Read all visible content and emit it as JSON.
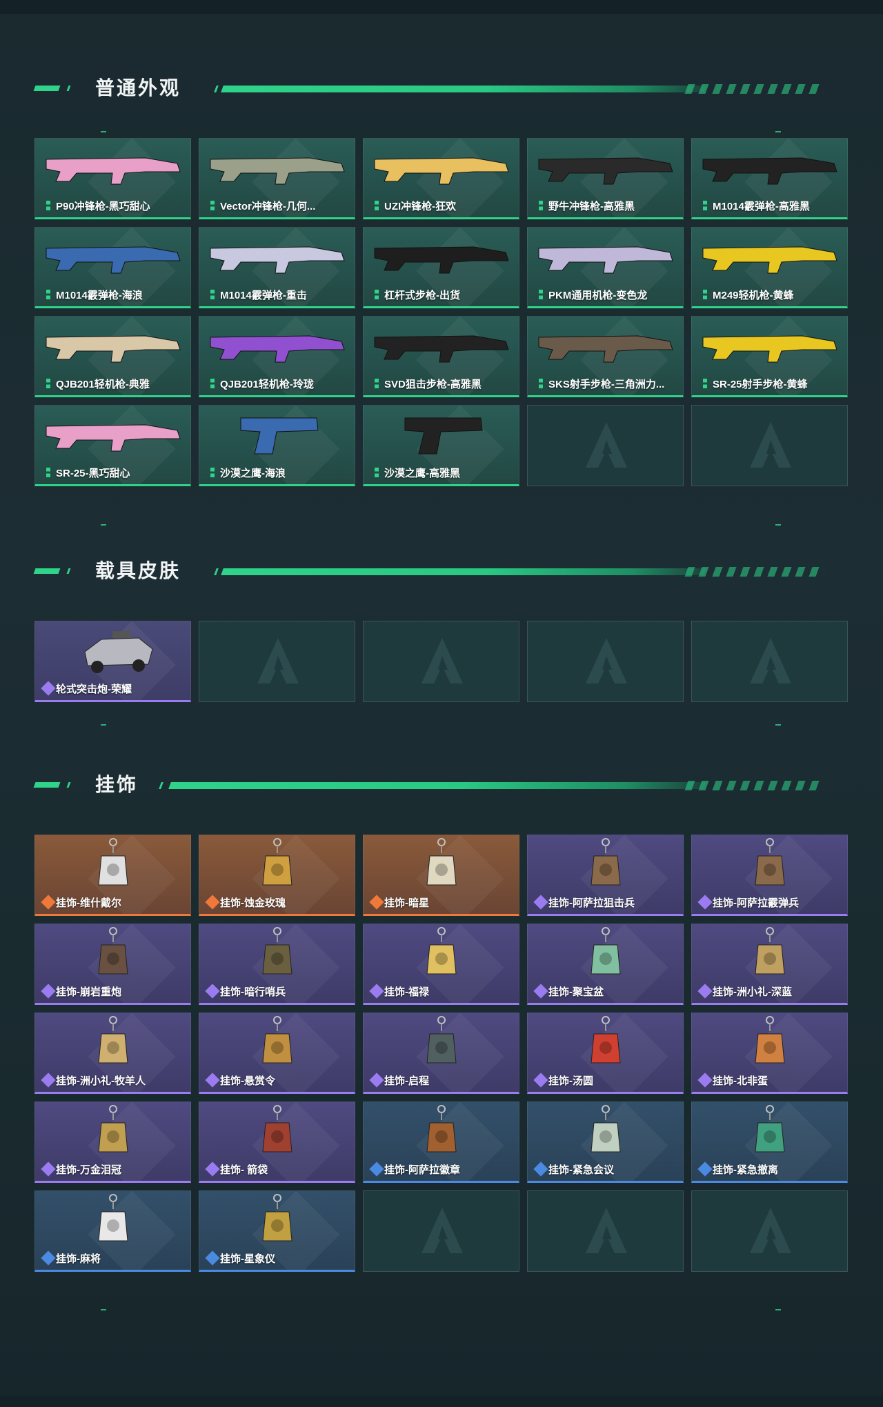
{
  "sections": {
    "weapons": {
      "title": "普通外观",
      "items": [
        {
          "label": "P90冲锋枪-黑巧甜心",
          "color": "#e8a0c8"
        },
        {
          "label": "Vector冲锋枪-几何...",
          "color": "#9aa08a"
        },
        {
          "label": "UZI冲锋枪-狂欢",
          "color": "#e8c060"
        },
        {
          "label": "野牛冲锋枪-高雅黑",
          "color": "#2a2a2a"
        },
        {
          "label": "M1014霰弹枪-高雅黑",
          "color": "#222222"
        },
        {
          "label": "M1014霰弹枪-海浪",
          "color": "#3a6ab0"
        },
        {
          "label": "M1014霰弹枪-重击",
          "color": "#c8c8e0"
        },
        {
          "label": "杠杆式步枪-出货",
          "color": "#1e1e1e"
        },
        {
          "label": "PKM通用机枪-变色龙",
          "color": "#c0b8d8"
        },
        {
          "label": "M249轻机枪-黄蜂",
          "color": "#e8c820"
        },
        {
          "label": "QJB201轻机枪-典雅",
          "color": "#d8c8a8"
        },
        {
          "label": "QJB201轻机枪-玲珑",
          "color": "#9050d0"
        },
        {
          "label": "SVD狙击步枪-高雅黑",
          "color": "#222222"
        },
        {
          "label": "SKS射手步枪-三角洲力...",
          "color": "#6a5a4a"
        },
        {
          "label": "SR-25射手步枪-黄蜂",
          "color": "#e8c820"
        },
        {
          "label": "SR-25-黑巧甜心",
          "color": "#e8a0c8"
        },
        {
          "label": "沙漠之鹰-海浪",
          "color": "#3a6ab0"
        },
        {
          "label": "沙漠之鹰-高雅黑",
          "color": "#222222"
        }
      ],
      "empty_slots": 2
    },
    "vehicles": {
      "title": "载具皮肤",
      "items": [
        {
          "label": "轮式突击炮-荣耀",
          "color": "#b8b8c0"
        }
      ],
      "empty_slots": 4
    },
    "charms": {
      "title": "挂饰",
      "items": [
        {
          "label": "挂饰-维什戴尔",
          "tier": "orange",
          "color": "#e0e0e0"
        },
        {
          "label": "挂饰-蚀金玫瑰",
          "tier": "orange",
          "color": "#d0a040"
        },
        {
          "label": "挂饰-暗星",
          "tier": "orange",
          "color": "#e0d8c0"
        },
        {
          "label": "挂饰-阿萨拉狙击兵",
          "tier": "purple",
          "color": "#8a6a4a"
        },
        {
          "label": "挂饰-阿萨拉霰弹兵",
          "tier": "purple",
          "color": "#8a6a4a"
        },
        {
          "label": "挂饰-崩岩重炮",
          "tier": "purple",
          "color": "#6a5040"
        },
        {
          "label": "挂饰-暗行哨兵",
          "tier": "purple",
          "color": "#6a6040"
        },
        {
          "label": "挂饰-福禄",
          "tier": "purple",
          "color": "#e0c060"
        },
        {
          "label": "挂饰-聚宝盆",
          "tier": "purple",
          "color": "#80c0a0"
        },
        {
          "label": "挂饰-洲小礼-深蓝",
          "tier": "purple",
          "color": "#c0a060"
        },
        {
          "label": "挂饰-洲小礼-牧羊人",
          "tier": "purple",
          "color": "#d0b070"
        },
        {
          "label": "挂饰-悬赏令",
          "tier": "purple",
          "color": "#c09040"
        },
        {
          "label": "挂饰-启程",
          "tier": "purple",
          "color": "#506060"
        },
        {
          "label": "挂饰-汤圆",
          "tier": "purple",
          "color": "#d04030"
        },
        {
          "label": "挂饰-北非蛋",
          "tier": "purple",
          "color": "#d08040"
        },
        {
          "label": "挂饰-万金泪冠",
          "tier": "purple",
          "color": "#c0a050"
        },
        {
          "label": "挂饰- 箭袋",
          "tier": "purple",
          "color": "#a04030"
        },
        {
          "label": "挂饰-阿萨拉徽章",
          "tier": "blue",
          "color": "#a06030"
        },
        {
          "label": "挂饰-紧急会议",
          "tier": "blue",
          "color": "#c0d0c0"
        },
        {
          "label": "挂饰-紧急撤离",
          "tier": "blue",
          "color": "#40a080"
        },
        {
          "label": "挂饰-麻将",
          "tier": "blue",
          "color": "#e8e8e8"
        },
        {
          "label": "挂饰-星象仪",
          "tier": "blue",
          "color": "#c0a040"
        }
      ],
      "empty_slots": 3
    }
  },
  "colors": {
    "accent": "#2fd38a",
    "background": "#1a2a2f",
    "tier_orange": "#f0783a",
    "tier_purple": "#9b7cf0",
    "tier_blue": "#4a8ae0"
  }
}
